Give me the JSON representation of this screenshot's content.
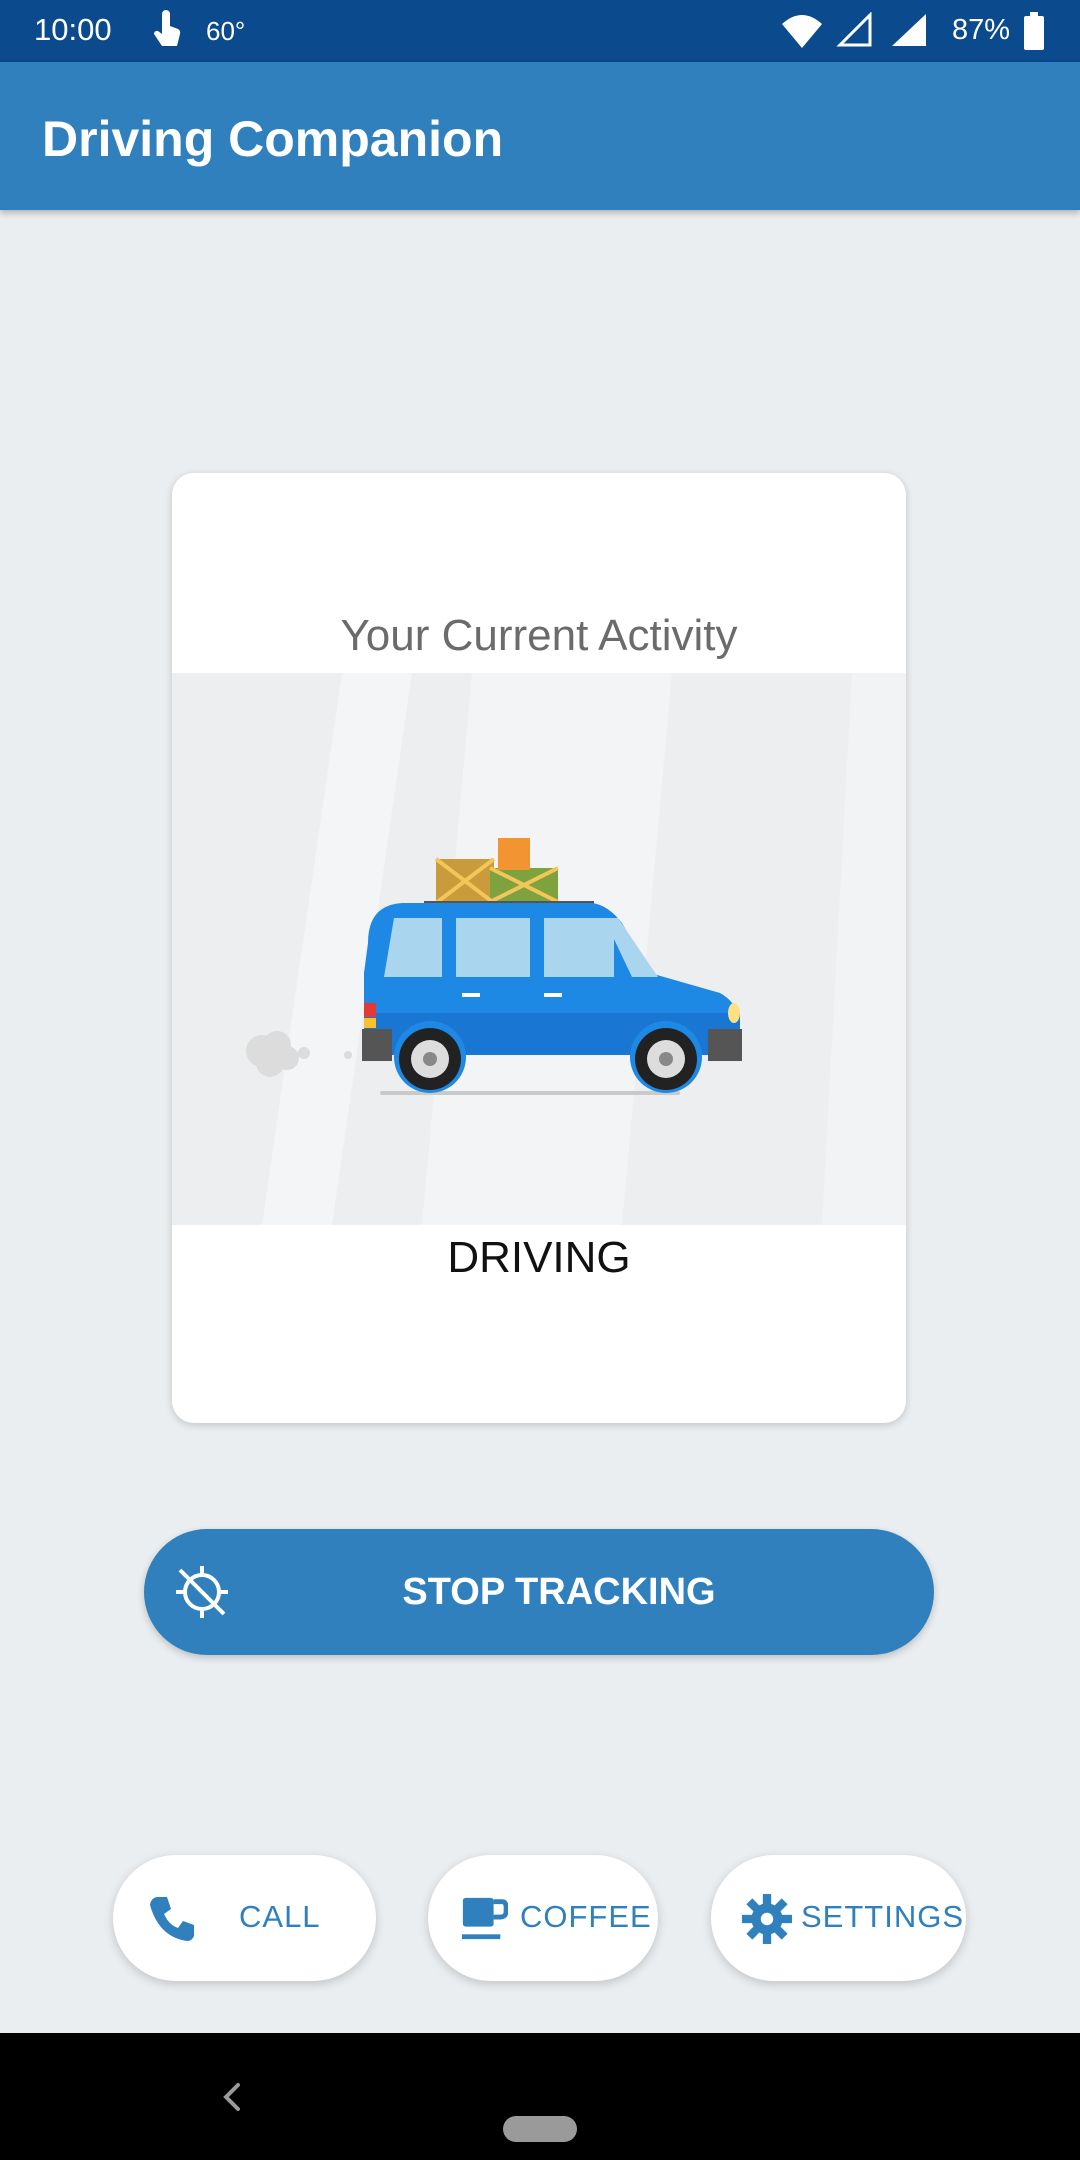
{
  "status_bar": {
    "time": "10:00",
    "temperature": "60°",
    "battery": "87%",
    "icons": [
      "touch-icon",
      "wifi-icon",
      "signal-icon",
      "battery-icon"
    ]
  },
  "app_bar": {
    "title": "Driving Companion"
  },
  "card": {
    "heading": "Your Current Activity",
    "activity": "DRIVING",
    "illustration": "car-illustration"
  },
  "stop_button": {
    "label": "STOP TRACKING",
    "icon": "location-off-icon"
  },
  "actions": {
    "call": {
      "label": "CALL",
      "icon": "phone-icon"
    },
    "coffee": {
      "label": "COFFEE",
      "icon": "coffee-icon"
    },
    "settings": {
      "label": "SETTINGS",
      "icon": "gear-icon"
    }
  },
  "colors": {
    "status_bar": "#0b4a8c",
    "primary": "#2f80bc",
    "background": "#ebeef0",
    "car_body": "#1e88e5"
  }
}
